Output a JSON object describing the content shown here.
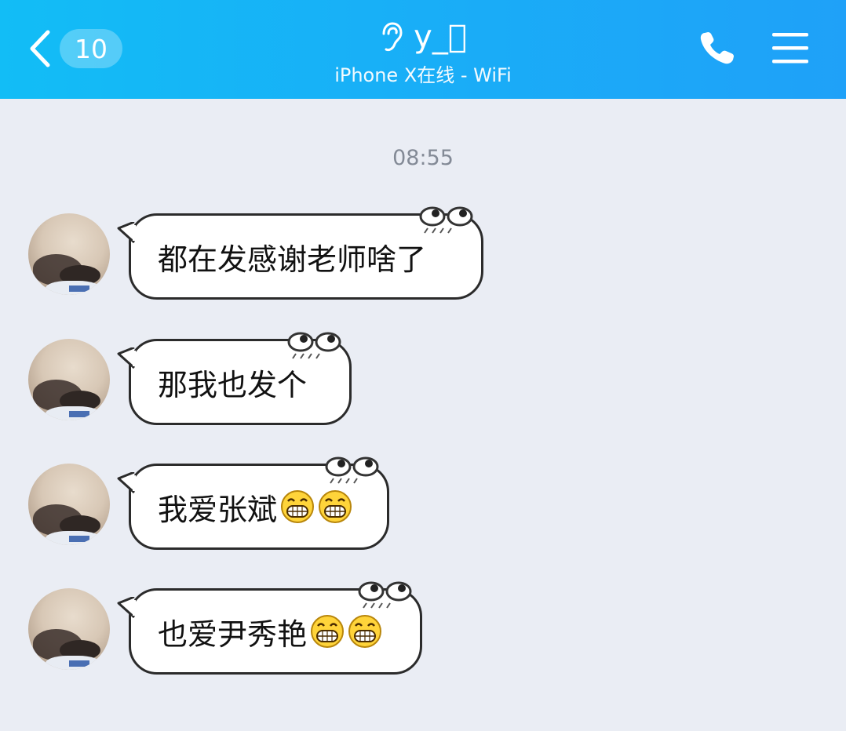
{
  "header": {
    "back_count": "10",
    "title": "y_⃣",
    "subtitle": "iPhone X在线 - WiFi",
    "bg_color": "#19aef7"
  },
  "chat": {
    "timestamp": "08:55",
    "messages": [
      {
        "text": "都在发感谢老师啥了",
        "emojis": 0
      },
      {
        "text": "那我也发个",
        "emojis": 0
      },
      {
        "text": "我爱张斌",
        "emojis": 2
      },
      {
        "text": "也爱尹秀艳",
        "emojis": 2
      }
    ]
  },
  "icons": {
    "back": "chevron-left-icon",
    "ear": "ear-icon",
    "call": "phone-icon",
    "menu": "menu-icon",
    "emoji": "grin-emoji-icon",
    "bubble_decor": "eyes-icon"
  }
}
